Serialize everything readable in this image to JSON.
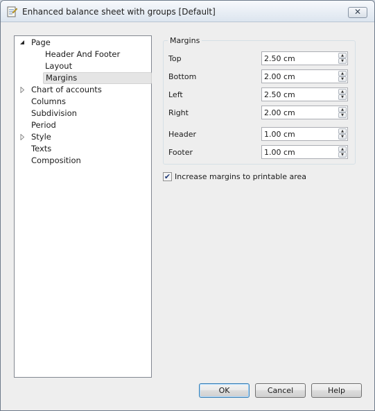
{
  "window": {
    "title": "Enhanced balance sheet with groups [Default]",
    "close_glyph": "✕"
  },
  "tree": {
    "items": [
      {
        "label": "Page",
        "expander": "expanded"
      },
      {
        "label": "Header And Footer"
      },
      {
        "label": "Layout"
      },
      {
        "label": "Margins",
        "selected": true
      },
      {
        "label": "Chart of accounts",
        "expander": "collapsed"
      },
      {
        "label": "Columns"
      },
      {
        "label": "Subdivision"
      },
      {
        "label": "Period"
      },
      {
        "label": "Style",
        "expander": "collapsed"
      },
      {
        "label": "Texts"
      },
      {
        "label": "Composition"
      }
    ]
  },
  "margins": {
    "group_title": "Margins",
    "fields": [
      {
        "label": "Top",
        "value": "2.50 cm"
      },
      {
        "label": "Bottom",
        "value": "2.00 cm"
      },
      {
        "label": "Left",
        "value": "2.50 cm"
      },
      {
        "label": "Right",
        "value": "2.00 cm"
      },
      {
        "label": "Header",
        "value": "1.00 cm"
      },
      {
        "label": "Footer",
        "value": "1.00 cm"
      }
    ],
    "spin_up_glyph": "▲",
    "spin_down_glyph": "▼"
  },
  "options": {
    "increase_margins": {
      "label": "Increase margins to printable area",
      "checked": true,
      "glyph": "✔"
    }
  },
  "buttons": {
    "ok": "OK",
    "cancel": "Cancel",
    "help": "Help"
  },
  "colors": {
    "selection": "#e5e5e5",
    "default_button_border": "#3c7fb1"
  }
}
